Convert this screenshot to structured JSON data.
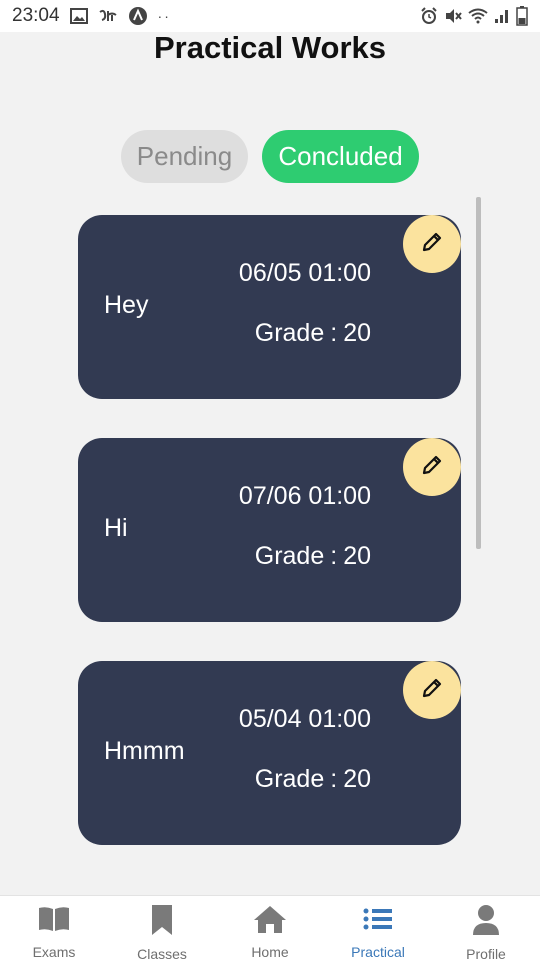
{
  "status_bar": {
    "time": "23:04",
    "left_icons": [
      "image-icon",
      "app-icon",
      "vpn-icon"
    ],
    "dots": "··",
    "right_icons": [
      "alarm-icon",
      "mute-icon",
      "wifi-icon",
      "signal-icon",
      "battery-icon"
    ]
  },
  "page": {
    "title": "Practical Works"
  },
  "tabs": [
    {
      "label": "Pending",
      "active": false
    },
    {
      "label": "Concluded",
      "active": true
    }
  ],
  "colors": {
    "accent_green": "#2ecc71",
    "card_bg": "#323a52",
    "edit_button_bg": "#fbe39e",
    "nav_active": "#3b78b8"
  },
  "works": [
    {
      "name": "Hey",
      "date": "06/05 01:00",
      "grade_label": "Grade",
      "grade_value": "20",
      "edit_icon": "pencil-icon"
    },
    {
      "name": "Hi",
      "date": "07/06 01:00",
      "grade_label": "Grade",
      "grade_value": "20",
      "edit_icon": "pencil-icon"
    },
    {
      "name": "Hmmm",
      "date": "05/04 01:00",
      "grade_label": "Grade",
      "grade_value": "20",
      "edit_icon": "pencil-icon"
    }
  ],
  "nav": [
    {
      "label": "Exams",
      "icon": "book-icon",
      "active": false
    },
    {
      "label": "Classes",
      "icon": "bookmark-icon",
      "active": false
    },
    {
      "label": "Home",
      "icon": "home-icon",
      "active": false
    },
    {
      "label": "Practical",
      "icon": "list-icon",
      "active": true
    },
    {
      "label": "Profile",
      "icon": "user-icon",
      "active": false
    }
  ]
}
